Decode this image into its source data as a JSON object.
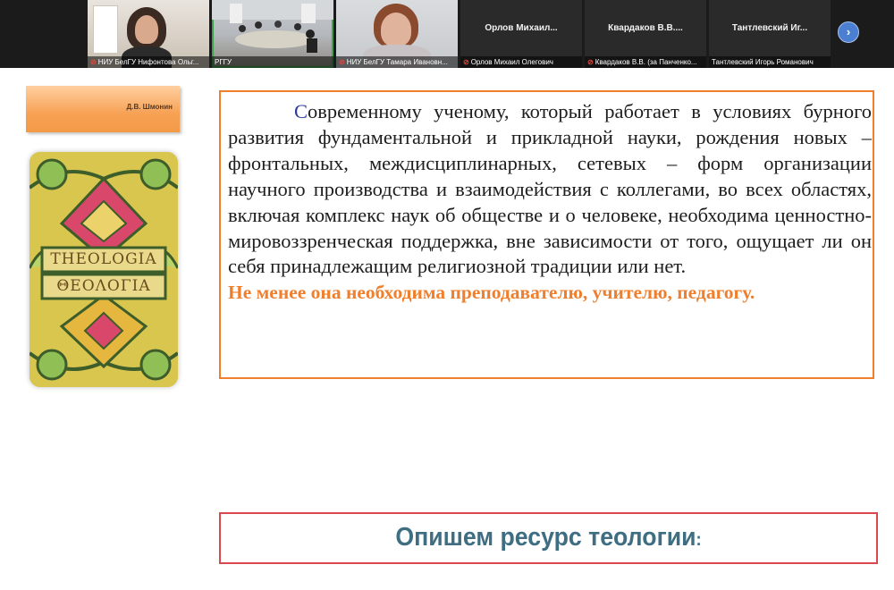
{
  "participants": [
    {
      "caption": "НИУ БелГУ Нифонтова Ольг...",
      "muted": true
    },
    {
      "caption": "РГГУ",
      "muted": false
    },
    {
      "caption": "НИУ БелГУ Тамара Ивановн...",
      "muted": true
    },
    {
      "name": "Орлов  Михаил...",
      "caption": "Орлов Михаил Олегович",
      "muted": true
    },
    {
      "name": "Квардаков  В.В....",
      "caption": "Квардаков В.В. (за Панченко...",
      "muted": true
    },
    {
      "name": "Тантлевский  Иг...",
      "caption": "Тантлевский Игорь Романович",
      "muted": false
    }
  ],
  "next_icon": "chevron-right-icon",
  "slide": {
    "author": "Д.В. Шмонин",
    "image_label_latin": "THEOLOGIA",
    "image_label_greek": "ΘΕΟΛΟΓΙΑ",
    "quote_first_letter": "С",
    "quote_body": "овременному ученому, который работает в условиях бурного развития фундаментальной и прикладной науки, рождения новых – фронтальных, междисциплинарных, сетевых – форм организации научного производства и взаимодействия с коллегами, во всех областях, включая комплекс наук об обществе и о человеке, необходима ценностно-мировоззренческая поддержка, вне зависимости от того, ощущает ли он себя принадлежащим религиозной традиции или нет.",
    "quote_emphasis": "Не менее она необходима преподавателю, учителю, педагогу.",
    "heading": "Опишем ресурс теологии",
    "heading_colon": ":"
  },
  "colors": {
    "accent_orange": "#f07f2d",
    "heading_border": "#d9474f",
    "heading_text": "#3f6e82",
    "capital": "#2f3a9c"
  }
}
